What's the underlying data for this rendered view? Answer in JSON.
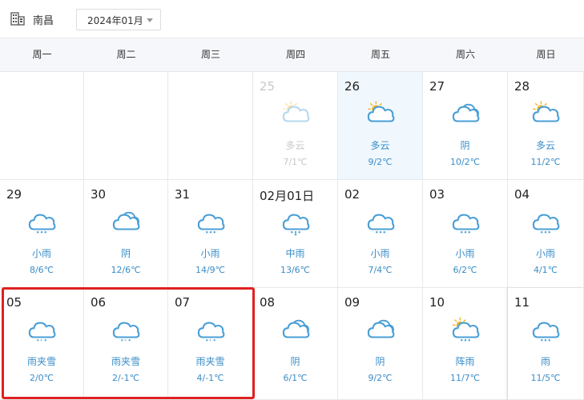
{
  "header": {
    "city": "南昌",
    "month": "2024年01月"
  },
  "weekdays": [
    "周一",
    "周二",
    "周三",
    "周四",
    "周五",
    "周六",
    "周日"
  ],
  "rows": [
    [
      {
        "date": "",
        "cond": "",
        "temp": "",
        "icon": ""
      },
      {
        "date": "",
        "cond": "",
        "temp": "",
        "icon": ""
      },
      {
        "date": "",
        "cond": "",
        "temp": "",
        "icon": ""
      },
      {
        "date": "25",
        "cond": "多云",
        "temp": "7/1℃",
        "icon": "partly-cloudy-icon",
        "state": "past"
      },
      {
        "date": "26",
        "cond": "多云",
        "temp": "9/2℃",
        "icon": "partly-cloudy-icon",
        "state": "today"
      },
      {
        "date": "27",
        "cond": "阴",
        "temp": "10/2℃",
        "icon": "overcast-icon"
      },
      {
        "date": "28",
        "cond": "多云",
        "temp": "11/2℃",
        "icon": "partly-cloudy-icon"
      }
    ],
    [
      {
        "date": "29",
        "cond": "小雨",
        "temp": "8/6℃",
        "icon": "light-rain-icon"
      },
      {
        "date": "30",
        "cond": "阴",
        "temp": "12/6℃",
        "icon": "overcast-icon"
      },
      {
        "date": "31",
        "cond": "小雨",
        "temp": "14/9℃",
        "icon": "light-rain-icon"
      },
      {
        "date": "02月01日",
        "cond": "中雨",
        "temp": "13/6℃",
        "icon": "moderate-rain-icon"
      },
      {
        "date": "02",
        "cond": "小雨",
        "temp": "7/4℃",
        "icon": "light-rain-icon"
      },
      {
        "date": "03",
        "cond": "小雨",
        "temp": "6/2℃",
        "icon": "light-rain-icon"
      },
      {
        "date": "04",
        "cond": "小雨",
        "temp": "4/1℃",
        "icon": "light-rain-icon"
      }
    ],
    [
      {
        "date": "05",
        "cond": "雨夹雪",
        "temp": "2/0℃",
        "icon": "sleet-icon"
      },
      {
        "date": "06",
        "cond": "雨夹雪",
        "temp": "2/-1℃",
        "icon": "sleet-icon"
      },
      {
        "date": "07",
        "cond": "雨夹雪",
        "temp": "4/-1℃",
        "icon": "sleet-icon"
      },
      {
        "date": "08",
        "cond": "阴",
        "temp": "6/1℃",
        "icon": "overcast-icon"
      },
      {
        "date": "09",
        "cond": "阴",
        "temp": "9/2℃",
        "icon": "overcast-icon"
      },
      {
        "date": "10",
        "cond": "阵雨",
        "temp": "11/7℃",
        "icon": "shower-icon"
      },
      {
        "date": "11",
        "cond": "雨",
        "temp": "11/5℃",
        "icon": "rain-icon",
        "state": "current"
      }
    ]
  ],
  "colors": {
    "cloud_stroke": "#4a9fd6",
    "sun": "#f5b82e",
    "text_blue": "#3a8dc8",
    "highlight": "#e02020"
  }
}
